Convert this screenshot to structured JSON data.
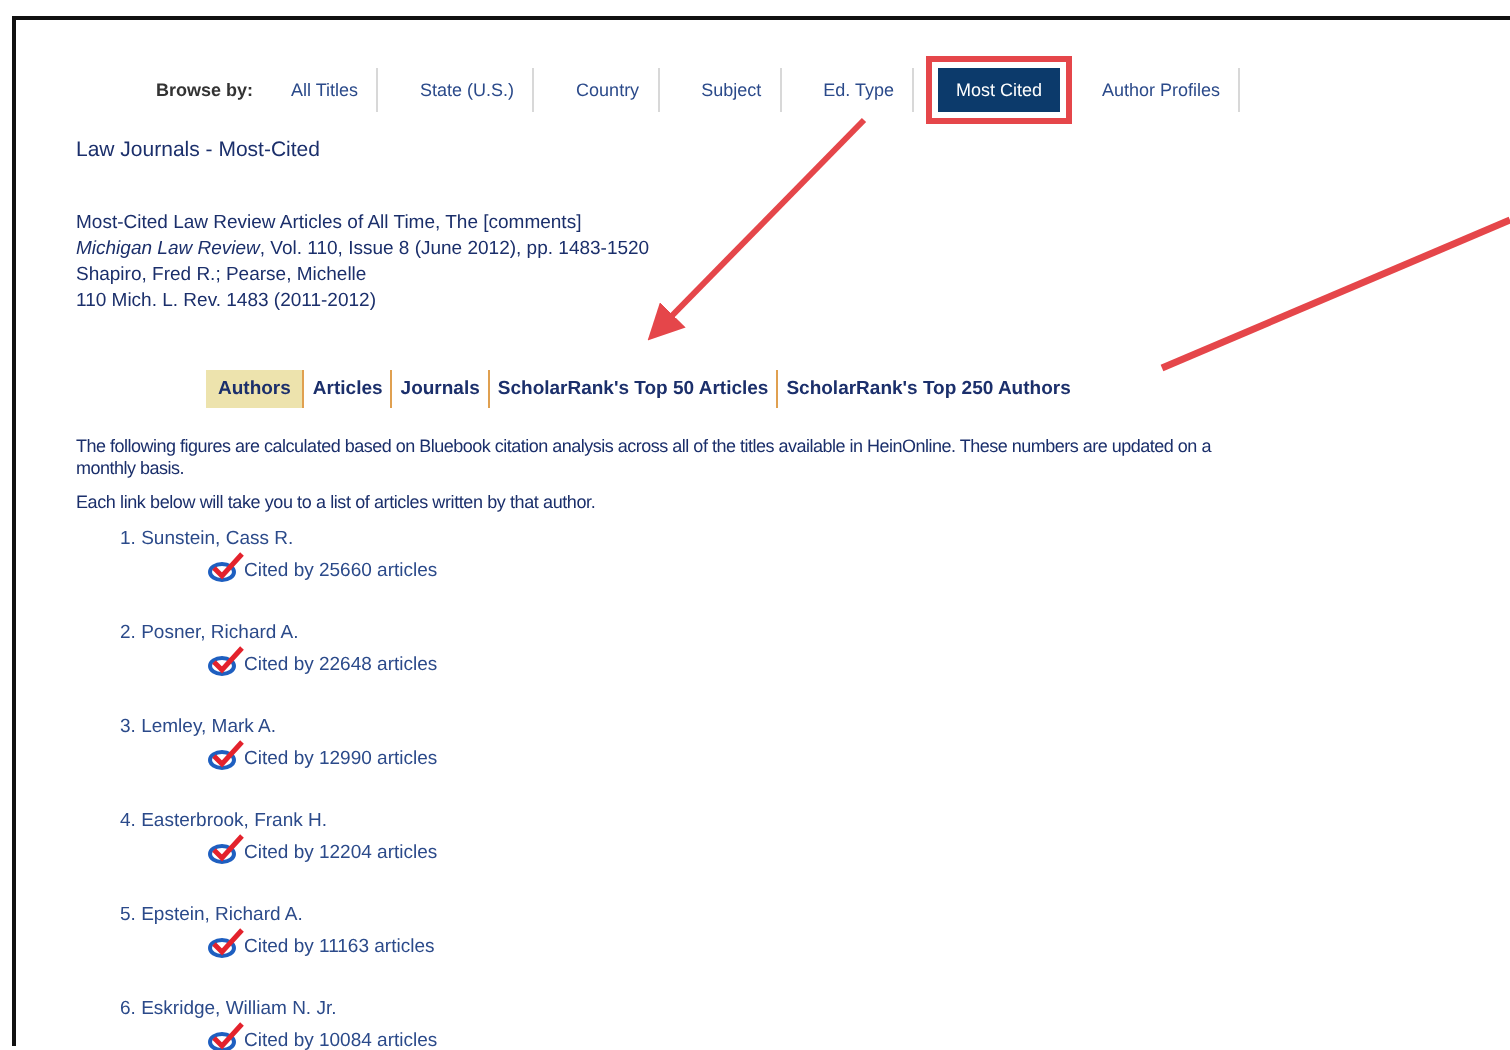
{
  "browse": {
    "label": "Browse by:",
    "tabs": [
      {
        "label": "All Titles",
        "selected": false,
        "highlighted": false
      },
      {
        "label": "State (U.S.)",
        "selected": false,
        "highlighted": false
      },
      {
        "label": "Country",
        "selected": false,
        "highlighted": false
      },
      {
        "label": "Subject",
        "selected": false,
        "highlighted": false
      },
      {
        "label": "Ed. Type",
        "selected": false,
        "highlighted": false
      },
      {
        "label": "Most Cited",
        "selected": true,
        "highlighted": true
      },
      {
        "label": "Author Profiles",
        "selected": false,
        "highlighted": false
      }
    ]
  },
  "title": "Law Journals - Most-Cited",
  "citation": {
    "title": "Most-Cited Law Review Articles of All Time, The [comments]",
    "source": "*Michigan Law Review*, Vol. 110, Issue 8 (June 2012), pp. 1483-1520",
    "authors": "Shapiro, Fred R.; Pearse, Michelle",
    "cite": "110 Mich. L. Rev. 1483 (2011-2012)"
  },
  "subnav": [
    {
      "label": "Authors",
      "selected": true
    },
    {
      "label": "Articles",
      "selected": false
    },
    {
      "label": "Journals",
      "selected": false
    },
    {
      "label": "ScholarRank's Top 50 Articles",
      "selected": false
    },
    {
      "label": "ScholarRank's Top 250 Authors",
      "selected": false
    }
  ],
  "intro_lines": [
    "The following figures are calculated based on Bluebook citation analysis across all of the titles available in HeinOnline. These numbers are updated on a",
    "monthly basis."
  ],
  "instruction": "Each link below will take you to a list of articles written by that author.",
  "authors": [
    {
      "rank": "1.",
      "name": "Sunstein, Cass R.",
      "cited": "Cited by 25660 articles"
    },
    {
      "rank": "2.",
      "name": "Posner, Richard A.",
      "cited": "Cited by 22648 articles"
    },
    {
      "rank": "3.",
      "name": "Lemley, Mark A.",
      "cited": "Cited by 12990 articles"
    },
    {
      "rank": "4.",
      "name": "Easterbrook, Frank H.",
      "cited": "Cited by 12204 articles"
    },
    {
      "rank": "5.",
      "name": "Epstein, Richard A.",
      "cited": "Cited by 11163 articles"
    },
    {
      "rank": "6.",
      "name": "Eskridge, William N. Jr.",
      "cited": "Cited by 10084 articles"
    }
  ]
}
